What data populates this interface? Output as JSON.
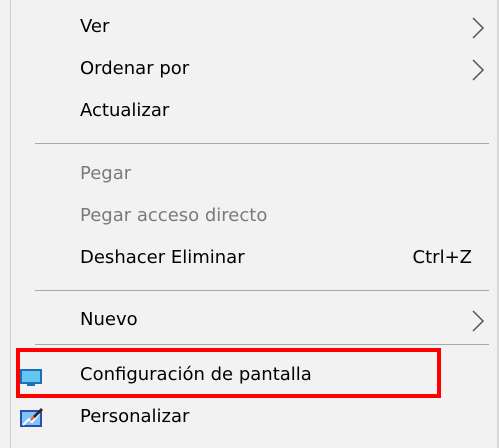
{
  "context_menu": {
    "items": [
      {
        "label": "Ver",
        "submenu": true,
        "enabled": true
      },
      {
        "label": "Ordenar por",
        "submenu": true,
        "enabled": true
      },
      {
        "label": "Actualizar",
        "submenu": false,
        "enabled": true
      },
      {
        "label": "Pegar",
        "submenu": false,
        "enabled": false
      },
      {
        "label": "Pegar acceso directo",
        "submenu": false,
        "enabled": false
      },
      {
        "label": "Deshacer Eliminar",
        "shortcut": "Ctrl+Z",
        "submenu": false,
        "enabled": true
      },
      {
        "label": "Nuevo",
        "submenu": true,
        "enabled": true
      },
      {
        "label": "Configuración de pantalla",
        "icon": "display-settings-icon",
        "submenu": false,
        "enabled": true,
        "highlighted": true
      },
      {
        "label": "Personalizar",
        "icon": "personalize-icon",
        "submenu": false,
        "enabled": true
      }
    ]
  },
  "colors": {
    "menu_background": "#f2f2f2",
    "separator": "#a8a8a8",
    "disabled_text": "#7a7a7a",
    "highlight_border": "#ff0000"
  }
}
